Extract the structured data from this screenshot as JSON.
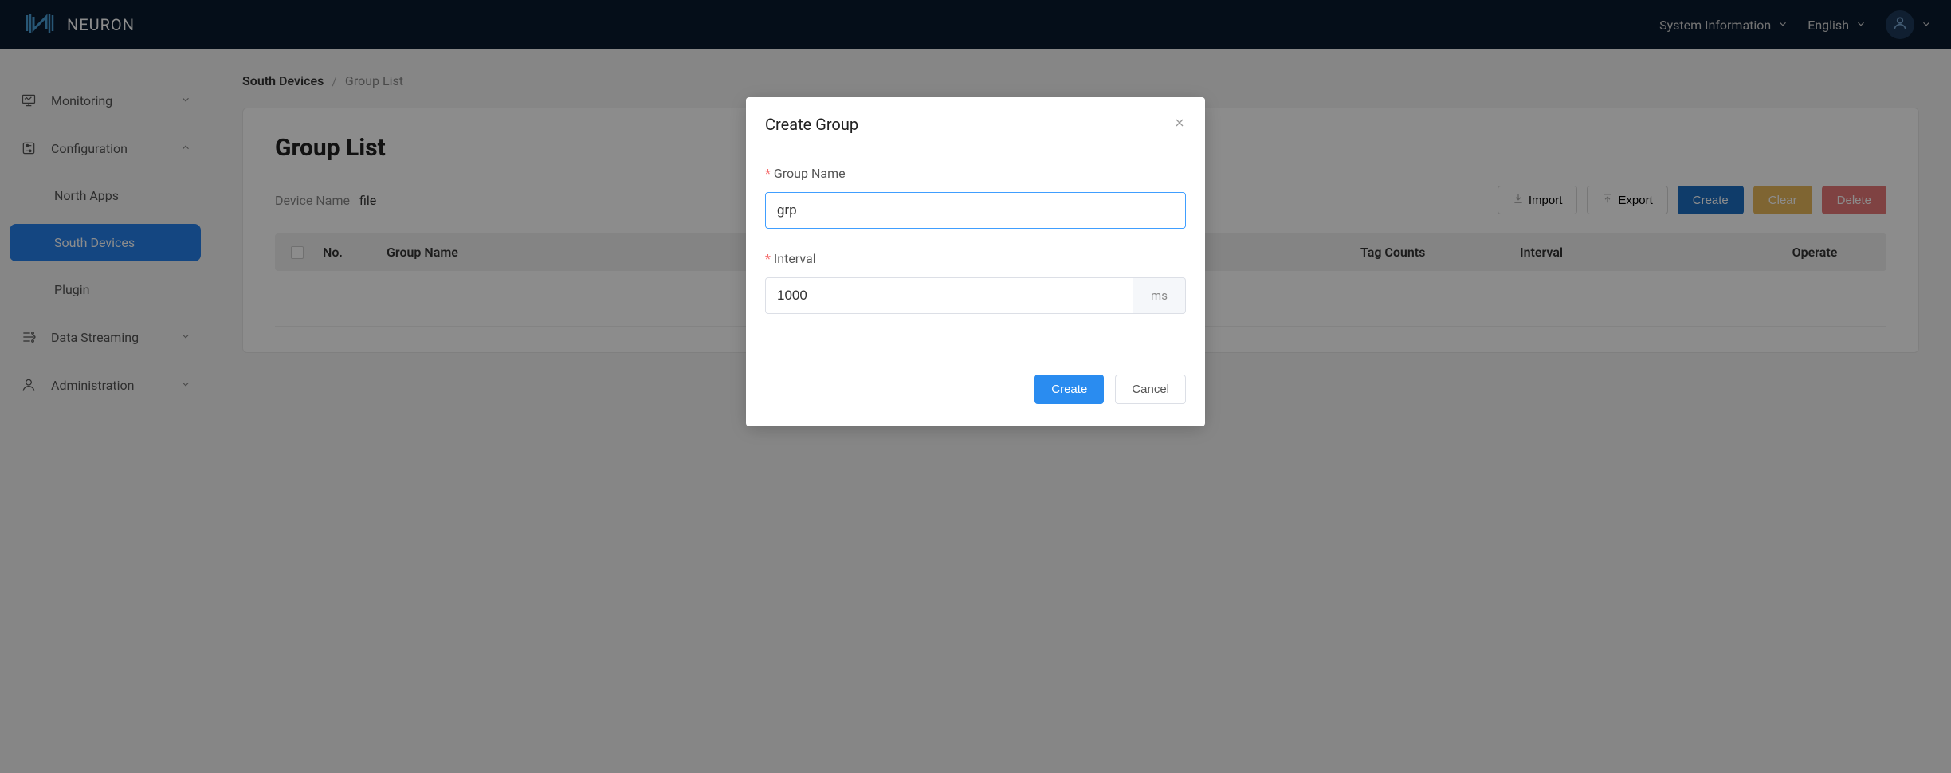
{
  "header": {
    "logo_text": "NEURON",
    "system_info": "System Information",
    "language": "English"
  },
  "sidebar": {
    "monitoring": "Monitoring",
    "configuration": "Configuration",
    "north_apps": "North Apps",
    "south_devices": "South Devices",
    "plugin": "Plugin",
    "data_streaming": "Data Streaming",
    "administration": "Administration"
  },
  "breadcrumb": {
    "parent": "South Devices",
    "current": "Group List"
  },
  "page": {
    "title": "Group List",
    "device_name_label": "Device Name",
    "device_name_value": "file"
  },
  "toolbar": {
    "import": "Import",
    "export": "Export",
    "create": "Create",
    "clear": "Clear",
    "delete": "Delete"
  },
  "table": {
    "col_no": "No.",
    "col_group_name": "Group Name",
    "col_tag_count": "Tag Counts",
    "col_interval": "Interval",
    "col_operate": "Operate"
  },
  "modal": {
    "title": "Create Group",
    "group_name_label": "Group Name",
    "group_name_value": "grp",
    "interval_label": "Interval",
    "interval_value": "1000",
    "interval_unit": "ms",
    "create_btn": "Create",
    "cancel_btn": "Cancel"
  }
}
